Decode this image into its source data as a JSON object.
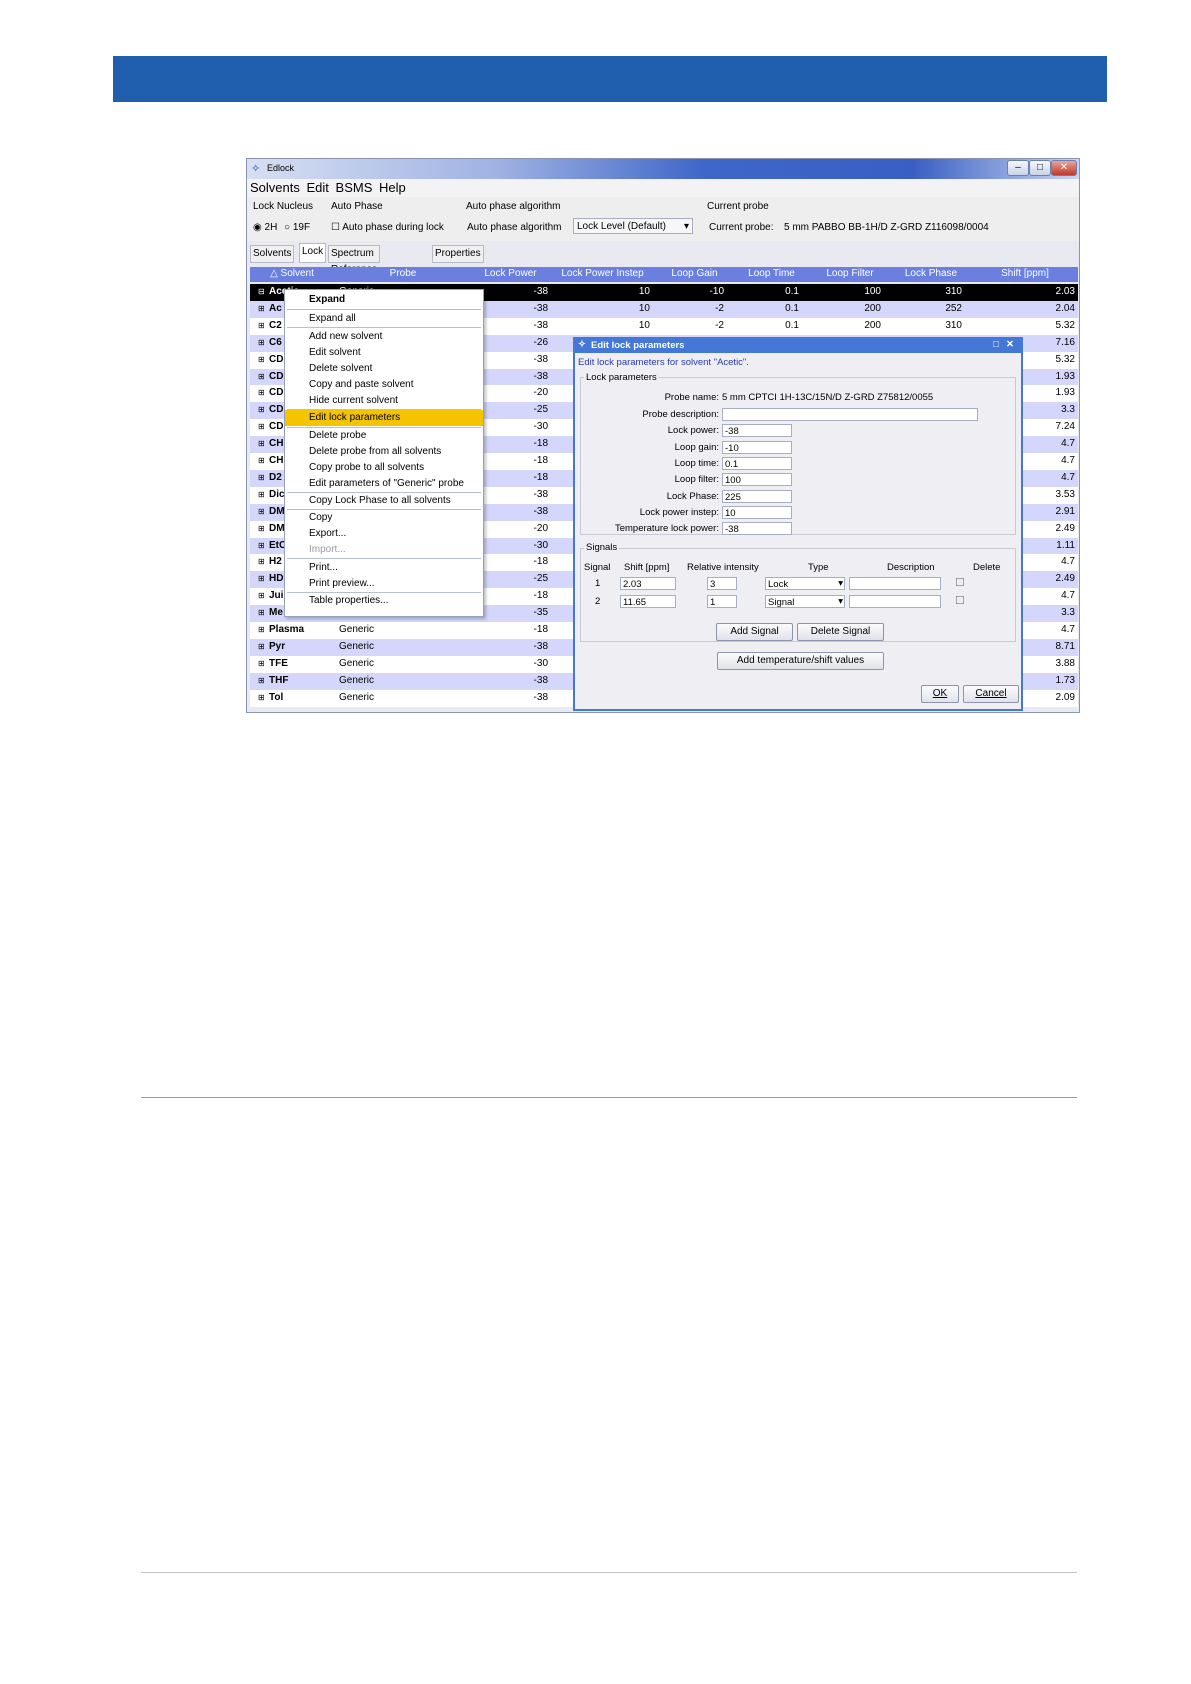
{
  "window": {
    "title": "Edlock"
  },
  "menu": [
    "Solvents",
    "Edit",
    "BSMS",
    "Help"
  ],
  "toolbar": {
    "lock_nucleus_label": "Lock Nucleus",
    "radio_2h": "2H",
    "radio_19f": "19F",
    "auto_phase_label": "Auto Phase",
    "auto_phase_check": "Auto phase during lock",
    "algo_header": "Auto phase algorithm",
    "algo_label": "Auto phase algorithm",
    "algo_value": "Lock Level (Default)",
    "current_probe_header": "Current probe",
    "current_probe_label": "Current probe:",
    "current_probe_value": "5 mm PABBO BB-1H/D Z-GRD Z116098/0004"
  },
  "tabs": [
    "Solvents",
    "Lock",
    "Spectrum Reference",
    "Properties"
  ],
  "table": {
    "headers": [
      "△ Solvent",
      "Probe",
      "Lock Power",
      "Lock Power Instep",
      "Loop Gain",
      "Loop Time",
      "Loop Filter",
      "Lock Phase",
      "Shift [ppm]"
    ],
    "rows": [
      {
        "solvent": "Acetic",
        "probe": "Generic",
        "lp": "-38",
        "lpi": "10",
        "lg": "-10",
        "lt": "0.1",
        "lf": "100",
        "ph": "310",
        "shift": "2.03"
      },
      {
        "solvent": "Ac",
        "probe": "",
        "lp": "-38",
        "lpi": "10",
        "lg": "-2",
        "lt": "0.1",
        "lf": "200",
        "ph": "252",
        "shift": "2.04"
      },
      {
        "solvent": "C2",
        "probe": "",
        "lp": "-38",
        "lpi": "10",
        "lg": "-2",
        "lt": "0.1",
        "lf": "200",
        "ph": "310",
        "shift": "5.32"
      },
      {
        "solvent": "C6",
        "probe": "",
        "lp": "-26",
        "lpi": "",
        "lg": "",
        "lt": "",
        "lf": "",
        "ph": "",
        "shift": "7.16"
      },
      {
        "solvent": "CD",
        "probe": "",
        "lp": "-38",
        "lpi": "",
        "lg": "",
        "lt": "",
        "lf": "",
        "ph": "",
        "shift": "5.32"
      },
      {
        "solvent": "CD",
        "probe": "",
        "lp": "-38",
        "lpi": "",
        "lg": "",
        "lt": "",
        "lf": "",
        "ph": "",
        "shift": "1.93"
      },
      {
        "solvent": "CD",
        "probe": "",
        "lp": "-20",
        "lpi": "",
        "lg": "",
        "lt": "",
        "lf": "",
        "ph": "",
        "shift": "1.93"
      },
      {
        "solvent": "CD",
        "probe": "",
        "lp": "-25",
        "lpi": "",
        "lg": "",
        "lt": "",
        "lf": "",
        "ph": "",
        "shift": "3.3"
      },
      {
        "solvent": "CD",
        "probe": "",
        "lp": "-30",
        "lpi": "",
        "lg": "",
        "lt": "",
        "lf": "",
        "ph": "",
        "shift": "7.24"
      },
      {
        "solvent": "CH",
        "probe": "",
        "lp": "-18",
        "lpi": "",
        "lg": "",
        "lt": "",
        "lf": "",
        "ph": "",
        "shift": "4.7"
      },
      {
        "solvent": "CH",
        "probe": "",
        "lp": "-18",
        "lpi": "",
        "lg": "",
        "lt": "",
        "lf": "",
        "ph": "",
        "shift": "4.7"
      },
      {
        "solvent": "D2",
        "probe": "",
        "lp": "-18",
        "lpi": "",
        "lg": "",
        "lt": "",
        "lf": "",
        "ph": "",
        "shift": "4.7"
      },
      {
        "solvent": "Dic",
        "probe": "",
        "lp": "-38",
        "lpi": "",
        "lg": "",
        "lt": "",
        "lf": "",
        "ph": "",
        "shift": "3.53"
      },
      {
        "solvent": "DM",
        "probe": "",
        "lp": "-38",
        "lpi": "",
        "lg": "",
        "lt": "",
        "lf": "",
        "ph": "",
        "shift": "2.91"
      },
      {
        "solvent": "DM",
        "probe": "",
        "lp": "-20",
        "lpi": "",
        "lg": "",
        "lt": "",
        "lf": "",
        "ph": "",
        "shift": "2.49"
      },
      {
        "solvent": "EtC",
        "probe": "",
        "lp": "-30",
        "lpi": "",
        "lg": "",
        "lt": "",
        "lf": "",
        "ph": "",
        "shift": "1.11"
      },
      {
        "solvent": "H2",
        "probe": "",
        "lp": "-18",
        "lpi": "",
        "lg": "",
        "lt": "",
        "lf": "",
        "ph": "",
        "shift": "4.7"
      },
      {
        "solvent": "HD",
        "probe": "",
        "lp": "-25",
        "lpi": "",
        "lg": "",
        "lt": "",
        "lf": "",
        "ph": "",
        "shift": "2.49"
      },
      {
        "solvent": "Jui",
        "probe": "",
        "lp": "-18",
        "lpi": "",
        "lg": "",
        "lt": "",
        "lf": "",
        "ph": "",
        "shift": "4.7"
      },
      {
        "solvent": "Me",
        "probe": "",
        "lp": "-35",
        "lpi": "",
        "lg": "",
        "lt": "",
        "lf": "",
        "ph": "",
        "shift": "3.3"
      },
      {
        "solvent": "Plasma",
        "probe": "Generic",
        "lp": "-18",
        "lpi": "",
        "lg": "",
        "lt": "",
        "lf": "",
        "ph": "",
        "shift": "4.7"
      },
      {
        "solvent": "Pyr",
        "probe": "Generic",
        "lp": "-38",
        "lpi": "",
        "lg": "",
        "lt": "",
        "lf": "",
        "ph": "",
        "shift": "8.71"
      },
      {
        "solvent": "TFE",
        "probe": "Generic",
        "lp": "-30",
        "lpi": "",
        "lg": "",
        "lt": "",
        "lf": "",
        "ph": "",
        "shift": "3.88"
      },
      {
        "solvent": "THF",
        "probe": "Generic",
        "lp": "-38",
        "lpi": "",
        "lg": "",
        "lt": "",
        "lf": "",
        "ph": "",
        "shift": "1.73"
      },
      {
        "solvent": "Tol",
        "probe": "Generic",
        "lp": "-38",
        "lpi": "",
        "lg": "",
        "lt": "",
        "lf": "",
        "ph": "",
        "shift": "2.09"
      }
    ]
  },
  "context_menu": {
    "items": [
      "Expand",
      "Expand all",
      "Add new solvent",
      "Edit solvent",
      "Delete solvent",
      "Copy and paste solvent",
      "Hide current solvent",
      "Edit lock parameters",
      "Delete probe",
      "Delete probe from all solvents",
      "Copy probe to all solvents",
      "Edit parameters of \"Generic\" probe",
      "Copy Lock Phase to all solvents",
      "Copy",
      "Export...",
      "Import...",
      "Print...",
      "Print preview...",
      "Table properties..."
    ],
    "highlight_color": "#f5c400"
  },
  "dialog": {
    "title": "Edit lock parameters",
    "subtitle": "Edit lock parameters for solvent \"Acetic\".",
    "group_lock": "Lock parameters",
    "probe_name_label": "Probe name:",
    "probe_name_value": "5 mm CPTCI 1H-13C/15N/D Z-GRD Z75812/0055",
    "fields": [
      {
        "label": "Probe description:",
        "value": ""
      },
      {
        "label": "Lock power:",
        "value": "-38"
      },
      {
        "label": "Loop gain:",
        "value": "-10"
      },
      {
        "label": "Loop time:",
        "value": "0.1"
      },
      {
        "label": "Loop filter:",
        "value": "100"
      },
      {
        "label": "Lock Phase:",
        "value": "225"
      },
      {
        "label": "Lock power instep:",
        "value": "10"
      },
      {
        "label": "Temperature lock power:",
        "value": "-38"
      }
    ],
    "group_signals": "Signals",
    "signal_headers": [
      "Signal",
      "Shift [ppm]",
      "Relative intensity",
      "Type",
      "Description",
      "Delete"
    ],
    "signals": [
      {
        "n": "1",
        "shift": "2.03",
        "intensity": "3",
        "type": "Lock"
      },
      {
        "n": "2",
        "shift": "11.65",
        "intensity": "1",
        "type": "Signal"
      }
    ],
    "add_signal": "Add Signal",
    "delete_signal": "Delete Signal",
    "add_temp": "Add temperature/shift values",
    "ok": "OK",
    "cancel": "Cancel"
  },
  "colors": {
    "brand_bar": "#1f5fae",
    "table_header": "#6b7fe0",
    "row_alt": "#d4d7fb",
    "dialog_accent": "#4478d4"
  }
}
